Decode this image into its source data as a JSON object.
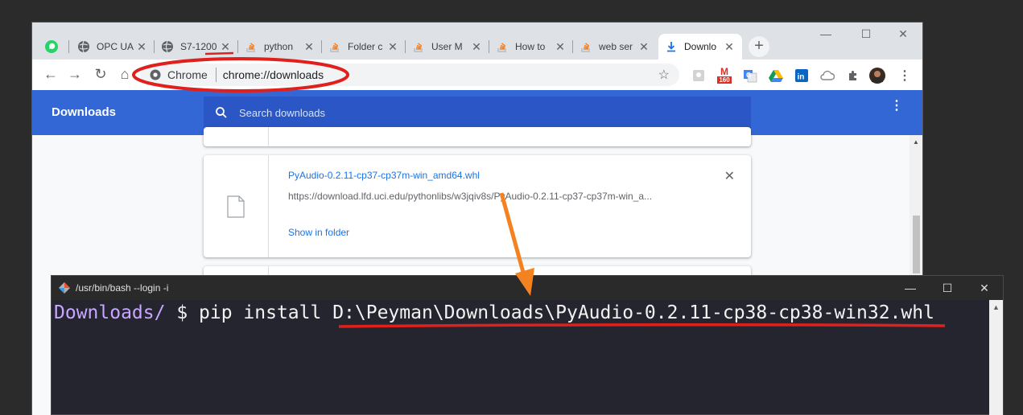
{
  "browser": {
    "tabs": [
      {
        "title": "",
        "icon": "whatsapp-icon"
      },
      {
        "title": "OPC UA",
        "icon": "globe-icon"
      },
      {
        "title": "S7-1200",
        "icon": "globe-icon"
      },
      {
        "title": "python",
        "icon": "stackoverflow-icon"
      },
      {
        "title": "Folder c",
        "icon": "stackoverflow-icon"
      },
      {
        "title": "User M",
        "icon": "stackoverflow-icon"
      },
      {
        "title": "How to",
        "icon": "stackoverflow-icon"
      },
      {
        "title": "web ser",
        "icon": "stackoverflow-icon"
      },
      {
        "title": "Downlo",
        "icon": "download-icon"
      }
    ],
    "omnibox": {
      "chip": "Chrome",
      "url": "chrome://downloads"
    },
    "ext_badge": "160"
  },
  "downloads": {
    "title": "Downloads",
    "search_placeholder": "Search downloads",
    "item": {
      "filename": "PyAudio-0.2.11-cp37-cp37m-win_amd64.whl",
      "url": "https://download.lfd.uci.edu/pythonlibs/w3jqiv8s/PyAudio-0.2.11-cp37-cp37m-win_a...",
      "action": "Show in folder"
    }
  },
  "terminal": {
    "title": "/usr/bin/bash --login -i",
    "prompt": "Downloads/",
    "command": " $ pip install D:\\Peyman\\Downloads\\PyAudio-0.2.11-cp38-cp38-win32.whl"
  },
  "colors": {
    "accent": "#3367d6",
    "annotation_red": "#e0201c",
    "arrow_orange": "#f58220"
  }
}
